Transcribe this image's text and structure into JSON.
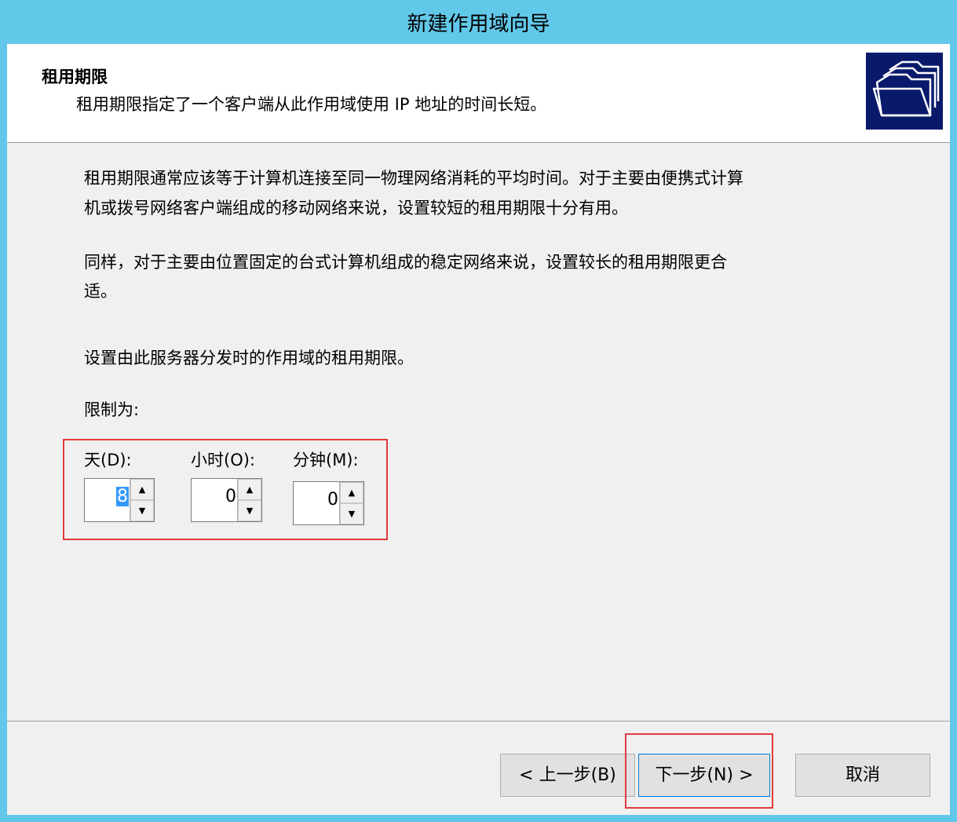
{
  "window": {
    "title": "新建作用域向导"
  },
  "header": {
    "title": "租用期限",
    "subtitle": "租用期限指定了一个客户端从此作用域使用 IP 地址的时间长短。",
    "icon": "folders-icon"
  },
  "body": {
    "para1_line1": "租用期限通常应该等于计算机连接至同一物理网络消耗的平均时间。对于主要由便携式计算",
    "para1_line2": "机或拨号网络客户端组成的移动网络来说，设置较短的租用期限十分有用。",
    "para2_line1": "同样，对于主要由位置固定的台式计算机组成的稳定网络来说，设置较长的租用期限更合",
    "para2_line2": "适。",
    "para3": "设置由此服务器分发时的作用域的租用期限。",
    "limit_label": "限制为:"
  },
  "lease": {
    "days_label": "天(D):",
    "days_value": "8",
    "hours_label": "小时(O):",
    "hours_value": "0",
    "minutes_label": "分钟(M):",
    "minutes_value": "0"
  },
  "buttons": {
    "back": "< 上一步(B)",
    "next": "下一步(N) >",
    "cancel": "取消"
  },
  "colors": {
    "titlebar": "#62c8ea",
    "highlight_box": "#e03a3a",
    "selection": "#3399ff"
  }
}
